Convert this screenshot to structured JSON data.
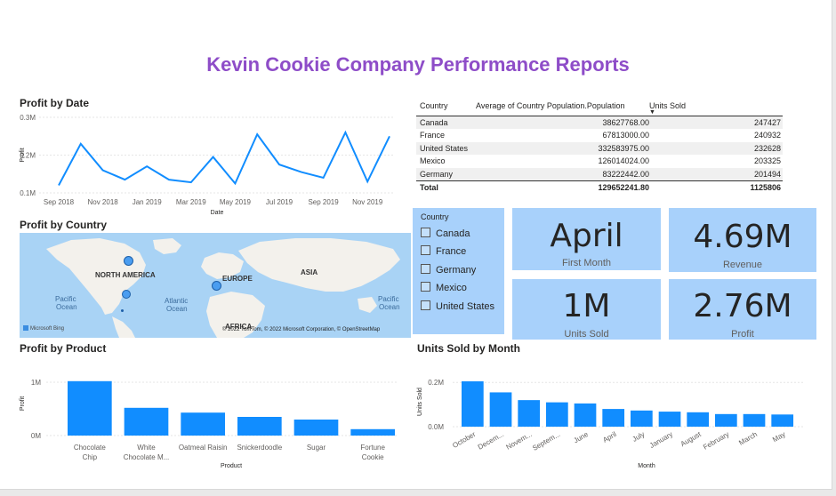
{
  "report_title": "Kevin Cookie Company Performance Reports",
  "profit_by_date": {
    "title": "Profit by Date",
    "chart_data": {
      "type": "line",
      "x": [
        "Sep 2018",
        "Oct 2018",
        "Nov 2018",
        "Dec 2018",
        "Jan 2019",
        "Feb 2019",
        "Mar 2019",
        "Apr 2019",
        "May 2019",
        "Jun 2019",
        "Jul 2019",
        "Aug 2019",
        "Sep 2019",
        "Oct 2019",
        "Nov 2019",
        "Dec 2019"
      ],
      "values": [
        0.12,
        0.23,
        0.16,
        0.135,
        0.17,
        0.135,
        0.128,
        0.195,
        0.125,
        0.255,
        0.175,
        0.155,
        0.14,
        0.26,
        0.13,
        0.25
      ],
      "x_tick_labels": [
        "Sep 2018",
        "Nov 2018",
        "Jan 2019",
        "Mar 2019",
        "May 2019",
        "Jul 2019",
        "Sep 2019",
        "Nov 2019"
      ],
      "y_tick_labels": [
        "0.1M",
        "0.2M",
        "0.3M"
      ],
      "ylim": [
        0.1,
        0.3
      ],
      "xlabel": "Date",
      "ylabel": "Profit",
      "color": "#118dff"
    }
  },
  "table": {
    "headers": [
      "Country",
      "Average of Country Population.Population",
      "Units Sold"
    ],
    "rows": [
      [
        "Canada",
        "38627768.00",
        "247427"
      ],
      [
        "France",
        "67813000.00",
        "240932"
      ],
      [
        "United States",
        "332583975.00",
        "232628"
      ],
      [
        "Mexico",
        "126014024.00",
        "203325"
      ],
      [
        "Germany",
        "83222442.00",
        "201494"
      ]
    ],
    "total": [
      "Total",
      "129652241.80",
      "1125806"
    ]
  },
  "profit_by_country": {
    "title": "Profit by Country",
    "labels": [
      "NORTH AMERICA",
      "EUROPE",
      "ASIA",
      "Pacific",
      "Ocean",
      "Atlantic",
      "Ocean",
      "Pacific",
      "Ocean",
      "AFRICA"
    ],
    "attribution": "© 2022 TomTom, © 2022 Microsoft Corporation, © OpenStreetMap",
    "bing": "Microsoft Bing"
  },
  "slicer": {
    "title": "Country",
    "options": [
      "Canada",
      "France",
      "Germany",
      "Mexico",
      "United States"
    ]
  },
  "cards": [
    {
      "value": "April",
      "label": "First Month"
    },
    {
      "value": "4.69M",
      "label": "Revenue"
    },
    {
      "value": "1M",
      "label": "Units Sold"
    },
    {
      "value": "2.76M",
      "label": "Profit"
    }
  ],
  "profit_by_product": {
    "title": "Profit by Product",
    "chart_data": {
      "type": "bar",
      "categories": [
        [
          "Chocolate",
          "Chip"
        ],
        [
          "White",
          "Chocolate M..."
        ],
        [
          "Oatmeal Raisin"
        ],
        [
          "Snickerdoodle"
        ],
        [
          "Sugar"
        ],
        [
          "Fortune",
          "Cookie"
        ]
      ],
      "values": [
        1.02,
        0.52,
        0.43,
        0.35,
        0.3,
        0.12
      ],
      "y_tick_labels": [
        "0M",
        "1M"
      ],
      "ylim": [
        0,
        1.2
      ],
      "xlabel": "Product",
      "ylabel": "Profit",
      "color": "#118dff"
    }
  },
  "units_by_month": {
    "title": "Units Sold by Month",
    "chart_data": {
      "type": "bar",
      "categories": [
        "October",
        "Decem...",
        "Novem...",
        "Septem...",
        "June",
        "April",
        "July",
        "January",
        "August",
        "February",
        "March",
        "May"
      ],
      "values": [
        0.205,
        0.155,
        0.12,
        0.11,
        0.105,
        0.08,
        0.073,
        0.068,
        0.065,
        0.057,
        0.057,
        0.055
      ],
      "y_tick_labels": [
        "0.0M",
        "0.2M"
      ],
      "ylim": [
        0,
        0.225
      ],
      "xlabel": "Month",
      "ylabel": "Units Sold",
      "color": "#118dff"
    }
  }
}
